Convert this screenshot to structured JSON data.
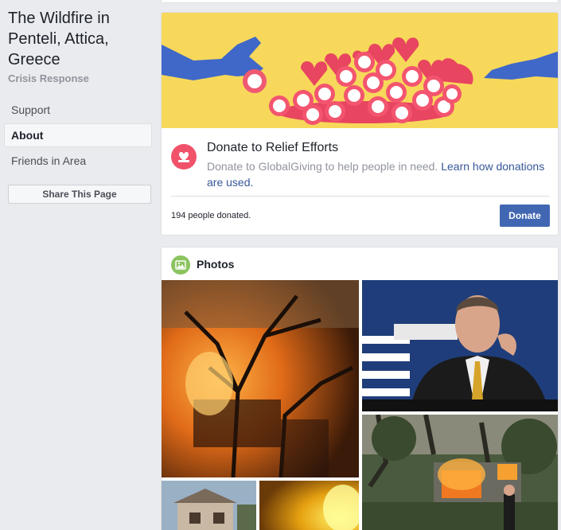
{
  "page": {
    "title": "The Wildfire in Penteli, Attica, Greece",
    "category": "Crisis Response"
  },
  "sidebar": {
    "items": [
      {
        "label": "Support",
        "active": false
      },
      {
        "label": "About",
        "active": true
      },
      {
        "label": "Friends in Area",
        "active": false
      }
    ],
    "share_label": "Share This Page"
  },
  "donate": {
    "title": "Donate to Relief Efforts",
    "description": "Donate to GlobalGiving to help people in need.",
    "link_text": "Learn how donations are used.",
    "count_text": "194 people donated.",
    "button_label": "Donate",
    "icon": "heart-donate-icon"
  },
  "photos": {
    "title": "Photos",
    "icon": "photos-icon"
  },
  "colors": {
    "accent": "#4267b2",
    "link": "#365899",
    "donate_icon": "#f0526a",
    "photos_icon": "#8ac45f",
    "banner_bg": "#f7d85a"
  }
}
